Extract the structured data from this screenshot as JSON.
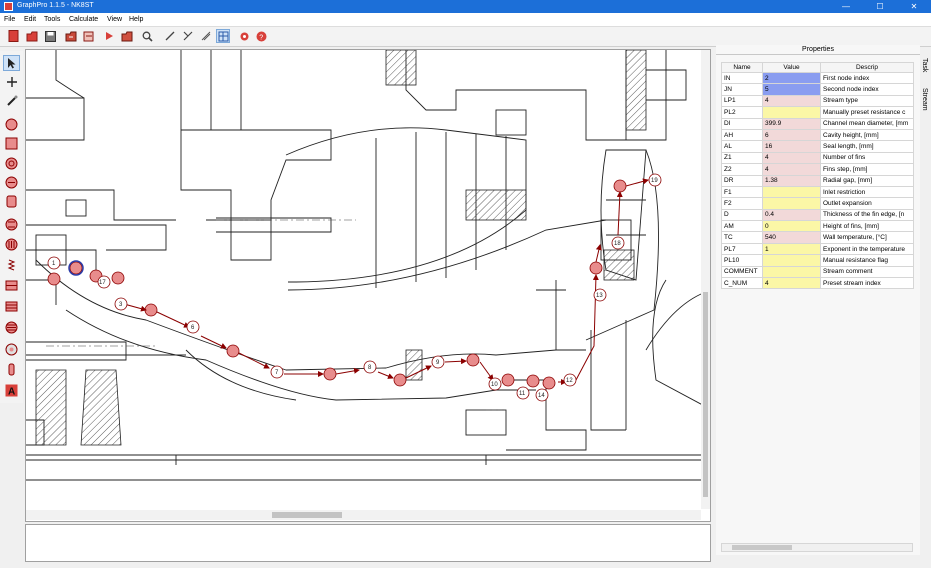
{
  "window": {
    "title": "GraphPro 1.1.5 - NK8ST",
    "min": "—",
    "max": "☐",
    "close": "✕"
  },
  "menu": [
    "File",
    "Edit",
    "Tools",
    "Calculate",
    "View",
    "Help"
  ],
  "properties": {
    "title": "Properties",
    "columns": [
      "Name",
      "Value",
      "Descrip"
    ],
    "rows": [
      {
        "name": "IN",
        "value": "2",
        "desc": "First node index",
        "color": "#8a9df0"
      },
      {
        "name": "JN",
        "value": "5",
        "desc": "Second node index",
        "color": "#8a9df0"
      },
      {
        "name": "LP1",
        "value": "4",
        "desc": "Stream type",
        "color": "#f2d9d9"
      },
      {
        "name": "PL2",
        "value": "",
        "desc": "Manually preset resistance c",
        "color": "#fbf7a6"
      },
      {
        "name": "DI",
        "value": "399.9",
        "desc": "Channel mean diameter, [mm",
        "color": "#f2d9d9"
      },
      {
        "name": "AH",
        "value": "6",
        "desc": "Cavity height, [mm]",
        "color": "#f2d9d9"
      },
      {
        "name": "AL",
        "value": "16",
        "desc": "Seal length, [mm]",
        "color": "#f2d9d9"
      },
      {
        "name": "Z1",
        "value": "4",
        "desc": "Number of fins",
        "color": "#f2d9d9"
      },
      {
        "name": "Z2",
        "value": "4",
        "desc": "Fins step, [mm]",
        "color": "#f2d9d9"
      },
      {
        "name": "DR",
        "value": "1.38",
        "desc": "Radial gap, [mm]",
        "color": "#f2d9d9"
      },
      {
        "name": "F1",
        "value": "",
        "desc": "Inlet restriction",
        "color": "#fbf7a6"
      },
      {
        "name": "F2",
        "value": "",
        "desc": "Outlet expansion",
        "color": "#fbf7a6"
      },
      {
        "name": "D",
        "value": "0.4",
        "desc": "Thickness of the fin edge, [n",
        "color": "#f2d9d9"
      },
      {
        "name": "AM",
        "value": "0",
        "desc": "Height of fins, [mm]",
        "color": "#fbf7a6"
      },
      {
        "name": "TC",
        "value": "540",
        "desc": "Wall temperature, [°C]",
        "color": "#f2d9d9"
      },
      {
        "name": "PL7",
        "value": "1",
        "desc": "Exponent in the temperature",
        "color": "#fbf7a6"
      },
      {
        "name": "PL10",
        "value": "",
        "desc": "Manual resistance flag",
        "color": "#fbf7a6"
      },
      {
        "name": "COMMENT",
        "value": "",
        "desc": "Stream comment",
        "color": "#fbf7a6"
      },
      {
        "name": "C_NUM",
        "value": "4",
        "desc": "Preset stream index",
        "color": "#fbf7a6"
      }
    ]
  },
  "side_tabs": [
    "Task",
    "Stream"
  ],
  "diagram": {
    "nodes": [
      {
        "label": "1"
      },
      {
        "label": "2"
      },
      {
        "label": "3"
      },
      {
        "label": "6"
      },
      {
        "label": "7"
      },
      {
        "label": "8"
      },
      {
        "label": "9"
      },
      {
        "label": "10"
      },
      {
        "label": "11"
      },
      {
        "label": "12"
      },
      {
        "label": "13"
      },
      {
        "label": "14"
      },
      {
        "label": "17"
      },
      {
        "label": "18"
      },
      {
        "label": "19"
      }
    ]
  },
  "colors": {
    "accent": "#1c6fd8",
    "node": "#e88c8c",
    "flow": "#8b0000"
  }
}
